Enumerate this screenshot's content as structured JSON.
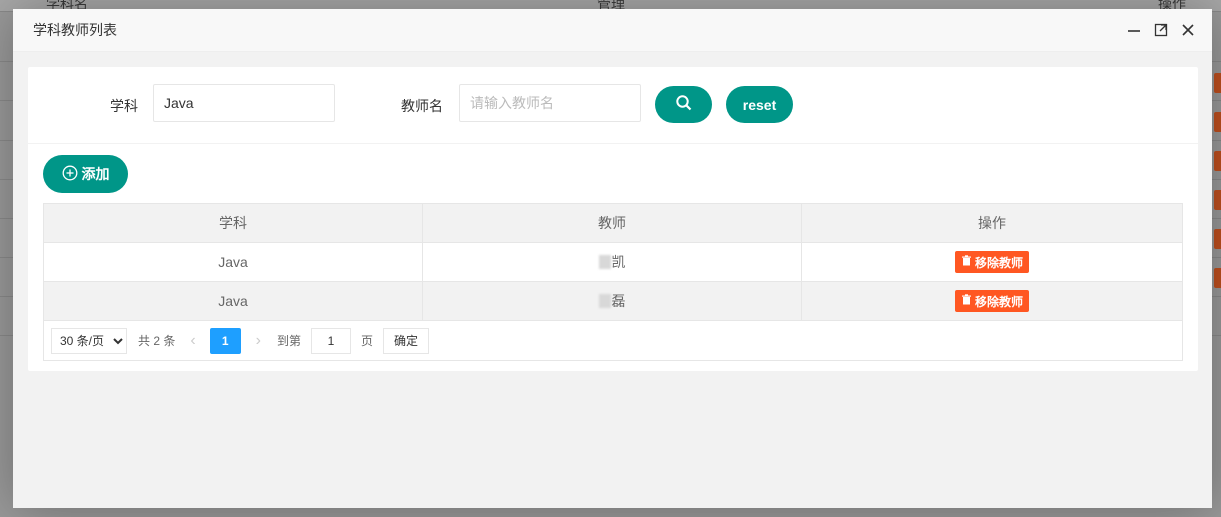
{
  "background": {
    "headers": [
      "学科名",
      "管理",
      "操作"
    ]
  },
  "modal": {
    "title": "学科教师列表"
  },
  "search": {
    "subject_label": "学科",
    "subject_value": "Java",
    "teacher_label": "教师名",
    "teacher_placeholder": "请输入教师名",
    "reset_label": "reset"
  },
  "toolbar": {
    "add_label": "添加"
  },
  "table": {
    "headers": [
      "学科",
      "教师",
      "操作"
    ],
    "rows": [
      {
        "subject": "Java",
        "teacher": "凯",
        "action": "移除教师"
      },
      {
        "subject": "Java",
        "teacher": "磊",
        "action": "移除教师"
      }
    ]
  },
  "pager": {
    "page_size": "30 条/页",
    "total": "共 2 条",
    "current": "1",
    "goto_label": "到第",
    "goto_value": "1",
    "page_label": "页",
    "confirm_label": "确定"
  },
  "colors": {
    "primary": "#009688",
    "danger": "#ff5722",
    "pager_active": "#1e9fff"
  }
}
